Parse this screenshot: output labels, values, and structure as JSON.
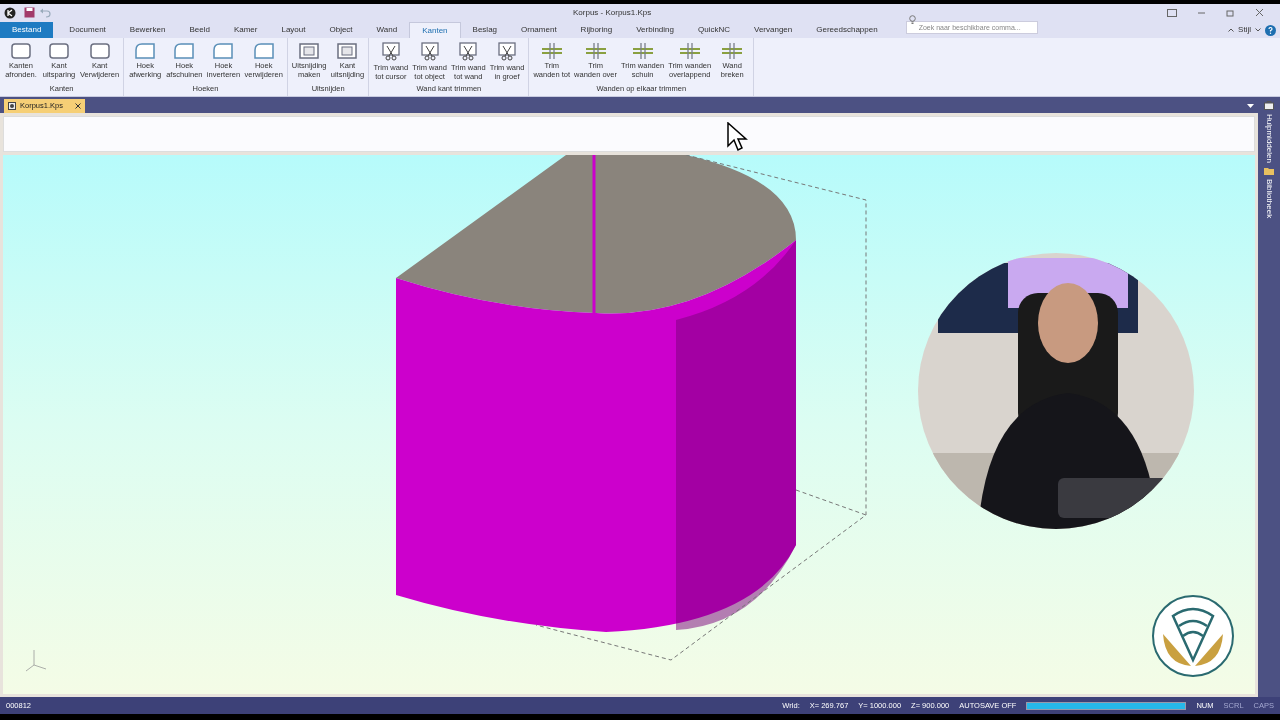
{
  "window": {
    "title": "Korpus - Korpus1.Kps"
  },
  "menu_tabs": [
    {
      "label": "Bestand",
      "selected": false,
      "kind": "file"
    },
    {
      "label": "Document",
      "selected": false,
      "kind": "tab"
    },
    {
      "label": "Bewerken",
      "selected": false,
      "kind": "tab"
    },
    {
      "label": "Beeld",
      "selected": false,
      "kind": "tab"
    },
    {
      "label": "Kamer",
      "selected": false,
      "kind": "tab"
    },
    {
      "label": "Layout",
      "selected": false,
      "kind": "tab"
    },
    {
      "label": "Object",
      "selected": false,
      "kind": "tab"
    },
    {
      "label": "Wand",
      "selected": false,
      "kind": "tab"
    },
    {
      "label": "Kanten",
      "selected": true,
      "kind": "tab"
    },
    {
      "label": "Beslag",
      "selected": false,
      "kind": "tab"
    },
    {
      "label": "Ornament",
      "selected": false,
      "kind": "tab"
    },
    {
      "label": "Rijboring",
      "selected": false,
      "kind": "tab"
    },
    {
      "label": "Verbinding",
      "selected": false,
      "kind": "tab"
    },
    {
      "label": "QuickNC",
      "selected": false,
      "kind": "tab"
    },
    {
      "label": "Vervangen",
      "selected": false,
      "kind": "tab"
    },
    {
      "label": "Gereedschappen",
      "selected": false,
      "kind": "tab"
    }
  ],
  "search": {
    "placeholder": "Zoek naar beschikbare comma..."
  },
  "style_menu": {
    "label": "Stijl"
  },
  "ribbon_groups": [
    {
      "title": "Kanten",
      "buttons": [
        {
          "label": "Kanten\nafronden.",
          "kind": "edge"
        },
        {
          "label": "Kant\nuitsparing",
          "kind": "edge"
        },
        {
          "label": "Kant\nVerwijderen",
          "kind": "edge"
        }
      ]
    },
    {
      "title": "Hoeken",
      "buttons": [
        {
          "label": "Hoek\nafwerking",
          "kind": "corner"
        },
        {
          "label": "Hoek\nafschuinen",
          "kind": "corner"
        },
        {
          "label": "Hoek\ninverteren",
          "kind": "corner"
        },
        {
          "label": "Hoek\nverwijderen",
          "kind": "corner"
        }
      ]
    },
    {
      "title": "Uitsnijden",
      "buttons": [
        {
          "label": "Uitsnijding\nmaken",
          "kind": "cutout"
        },
        {
          "label": "Kant\nuitsnijding",
          "kind": "cutout"
        }
      ]
    },
    {
      "title": "Wand kant trimmen",
      "buttons": [
        {
          "label": "Trim wand\ntot cursor",
          "kind": "trim"
        },
        {
          "label": "Trim wand\ntot object",
          "kind": "trim"
        },
        {
          "label": "Trim wand\ntot wand",
          "kind": "trim"
        },
        {
          "label": "Trim wand\nin groef",
          "kind": "trim"
        }
      ]
    },
    {
      "title": "Wanden op elkaar trimmen",
      "buttons": [
        {
          "label": "Trim\nwanden tot",
          "kind": "cross"
        },
        {
          "label": "Trim\nwanden over",
          "kind": "cross"
        },
        {
          "label": "Trim wanden\nschuin",
          "kind": "cross"
        },
        {
          "label": "Trim wanden\noverlappend",
          "kind": "cross"
        },
        {
          "label": "Wand\nbreken",
          "kind": "cross"
        }
      ]
    }
  ],
  "document_tabs": [
    {
      "label": "Korpus1.Kps",
      "selected": true
    }
  ],
  "side_panels": [
    {
      "label": "Hulpmiddelen",
      "kind": "toolbox"
    },
    {
      "label": "Bibliotheek",
      "kind": "folder"
    }
  ],
  "status_bar": {
    "code": "000812",
    "coord_label": "Wrld:",
    "x": "X= 269.767",
    "y": "Y= 1000.000",
    "z": "Z= 900.000",
    "autosave": "AUTOSAVE OFF",
    "progress": {
      "level": 1
    },
    "indicators": [
      {
        "label": "NUM",
        "active": true
      },
      {
        "label": "SCRL",
        "active": false
      },
      {
        "label": "CAPS",
        "active": false
      }
    ]
  }
}
